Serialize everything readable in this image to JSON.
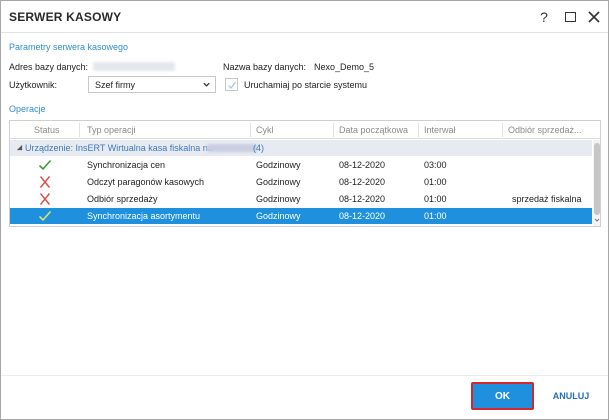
{
  "window": {
    "title": "SERWER KASOWY",
    "help_label": "?",
    "colors": {
      "accent": "#1e90dd",
      "section": "#2f8ed0",
      "ok_border": "#d92525",
      "error_icon": "#d9534f",
      "ok_icon": "#3a9a3a"
    }
  },
  "params": {
    "section_title": "Parametry serwera kasowego",
    "db_address_label": "Adres bazy danych:",
    "db_name_label": "Nazwa bazy danych:",
    "db_name_value": "Nexo_Demo_5",
    "user_label": "Użytkownik:",
    "user_value": "Szef firmy",
    "autostart_label": "Uruchamiaj po starcie systemu",
    "autostart_checked": true
  },
  "operations": {
    "section_title": "Operacje",
    "columns": [
      "Status",
      "Typ operacji",
      "Cykl",
      "Data początkowa",
      "Interwał",
      "Odbiór sprzedaż..."
    ],
    "group": {
      "prefix": "Urządzenie: ",
      "device": "InsERT Wirtualna kasa fiskalna na",
      "count": "(4)"
    },
    "rows": [
      {
        "status": "ok-icon",
        "type": "Synchronizacja cen",
        "cycle": "Godzinowy",
        "start_date": "08-12-2020",
        "interval": "03:00",
        "sales": ""
      },
      {
        "status": "error-icon",
        "type": "Odczyt paragonów kasowych",
        "cycle": "Godzinowy",
        "start_date": "08-12-2020",
        "interval": "01:00",
        "sales": ""
      },
      {
        "status": "error-icon",
        "type": "Odbiór sprzedaży",
        "cycle": "Godzinowy",
        "start_date": "08-12-2020",
        "interval": "01:00",
        "sales": "sprzedaż fiskalna"
      },
      {
        "status": "ok-icon",
        "type": "Synchronizacja asortymentu",
        "cycle": "Godzinowy",
        "start_date": "08-12-2020",
        "interval": "01:00",
        "sales": "",
        "selected": true
      }
    ]
  },
  "footer": {
    "ok_label": "OK",
    "cancel_label": "ANULUJ"
  }
}
